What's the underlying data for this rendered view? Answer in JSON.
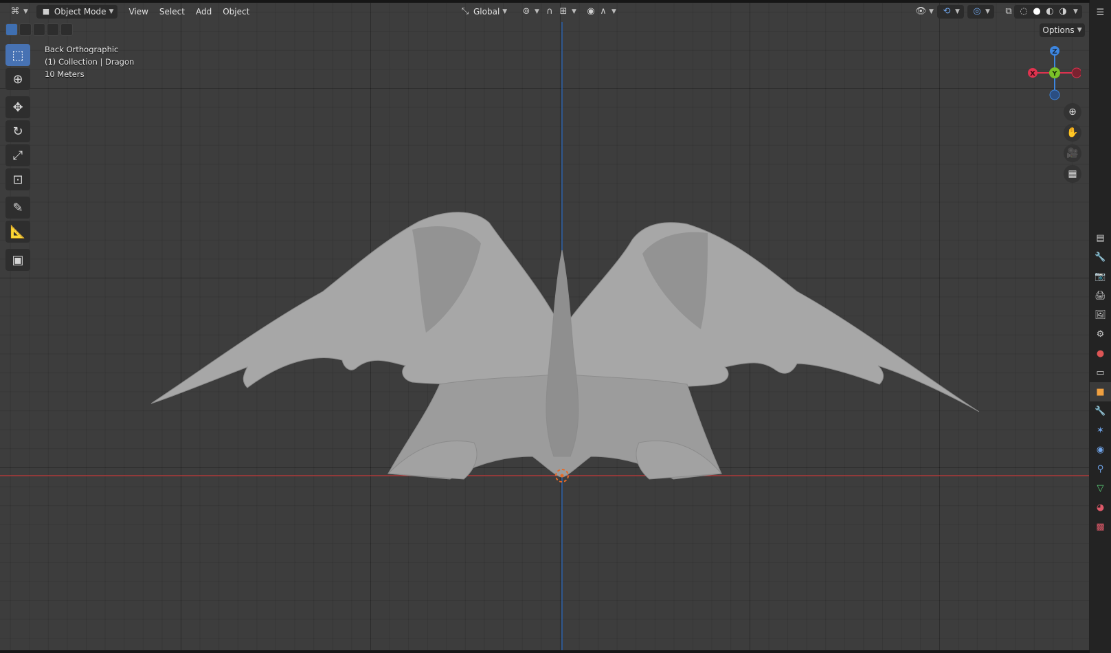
{
  "header": {
    "editor_type_icon": "3d-viewport-icon",
    "mode_label": "Object Mode",
    "menus": [
      "View",
      "Select",
      "Add",
      "Object"
    ],
    "transform_orientation": "Global"
  },
  "overlay": {
    "view_name": "Back Orthographic",
    "collection_object": "(1) Collection | Dragon",
    "scale": "10 Meters"
  },
  "options_label": "Options",
  "gizmo": {
    "axis_z": "Z",
    "axis_y": "Y",
    "axis_x": "X",
    "colors": {
      "x": "#e0334f",
      "y": "#7ac228",
      "z": "#3d86e0"
    }
  },
  "toolbar": {
    "tools": [
      "select-box-icon",
      "cursor-icon",
      "move-icon",
      "rotate-icon",
      "scale-icon",
      "transform-icon",
      "annotate-icon",
      "measure-icon",
      "add-cube-icon"
    ]
  },
  "navigation": [
    "zoom-icon",
    "pan-hand-icon",
    "camera-icon",
    "grid-icon"
  ],
  "properties_tabs": [
    "tool-icon",
    "render-icon",
    "output-icon",
    "view-layer-icon",
    "scene-icon",
    "world-icon",
    "collection-icon",
    "object-icon",
    "modifier-icon",
    "particles-icon",
    "physics-icon",
    "constraints-icon",
    "data-icon",
    "material-icon",
    "texture-icon"
  ],
  "colors": {
    "viewport_bg": "#3d3d3d",
    "axis_x_line": "#c63a3a",
    "axis_z_line": "#2a5fa6",
    "accent": "#4772b3"
  }
}
